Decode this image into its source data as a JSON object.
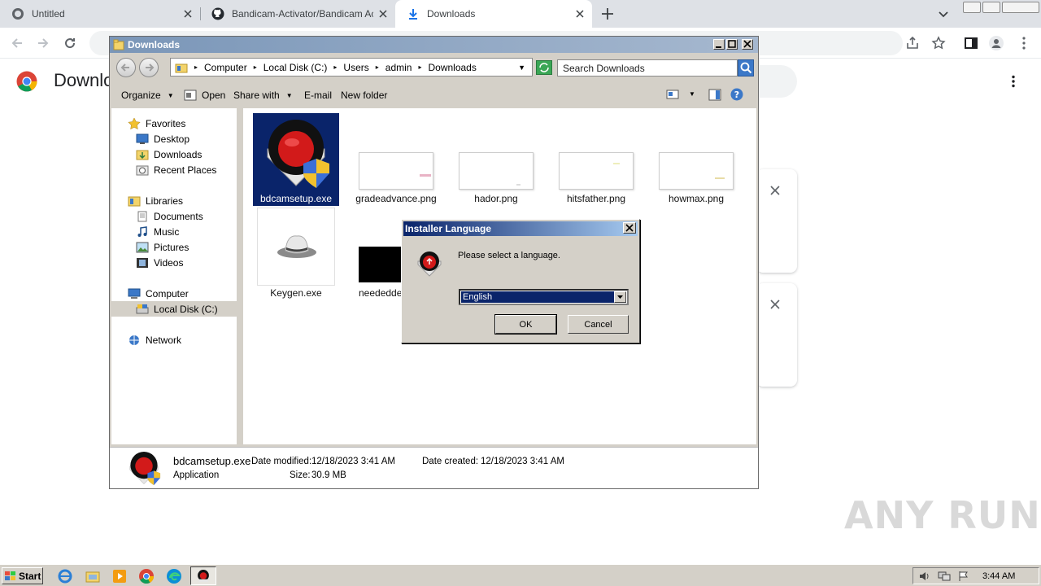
{
  "browser": {
    "tabs": [
      {
        "title": "Untitled",
        "icon": "globe-icon",
        "active": false
      },
      {
        "title": "Bandicam-Activator/Bandicam Activator",
        "icon": "github-icon",
        "active": false
      },
      {
        "title": "Downloads",
        "icon": "download-icon",
        "active": true
      }
    ]
  },
  "downloads_page": {
    "title": "Downloads"
  },
  "explorer": {
    "window_title": "Downloads",
    "breadcrumbs": [
      "Computer",
      "Local Disk (C:)",
      "Users",
      "admin",
      "Downloads"
    ],
    "search_placeholder": "Search Downloads",
    "commands": {
      "organize": "Organize",
      "open": "Open",
      "share_with": "Share with",
      "email": "E-mail",
      "new_folder": "New folder"
    },
    "nav": {
      "favorites": "Favorites",
      "desktop": "Desktop",
      "downloads": "Downloads",
      "recent_places": "Recent Places",
      "libraries": "Libraries",
      "documents": "Documents",
      "music": "Music",
      "pictures": "Pictures",
      "videos": "Videos",
      "computer": "Computer",
      "local_disk": "Local Disk (C:)",
      "network": "Network"
    },
    "files": [
      {
        "name": "bdcamsetup.exe",
        "selected": true
      },
      {
        "name": "gradeadvance.png"
      },
      {
        "name": "hador.png"
      },
      {
        "name": "hitsfather.png"
      },
      {
        "name": "howmax.png"
      },
      {
        "name": "Keygen.exe"
      },
      {
        "name": "neededdef"
      }
    ],
    "details": {
      "name": "bdcamsetup.exe",
      "type": "Application",
      "date_modified_label": "Date modified:",
      "date_modified": "12/18/2023 3:41 AM",
      "date_created_label": "Date created:",
      "date_created": "12/18/2023 3:41 AM",
      "size_label": "Size:",
      "size": "30.9 MB"
    }
  },
  "dialog": {
    "title": "Installer Language",
    "message": "Please select a language.",
    "selected_language": "English",
    "ok_label": "OK",
    "cancel_label": "Cancel"
  },
  "watermark": "ANY RUN",
  "taskbar": {
    "start_label": "Start",
    "clock": "3:44 AM"
  },
  "colors": {
    "dialog_title": "#0a246a",
    "explorer_title": "#7a96b8",
    "selection": "#0a246a",
    "chrome_tabbar": "#dee1e6"
  }
}
